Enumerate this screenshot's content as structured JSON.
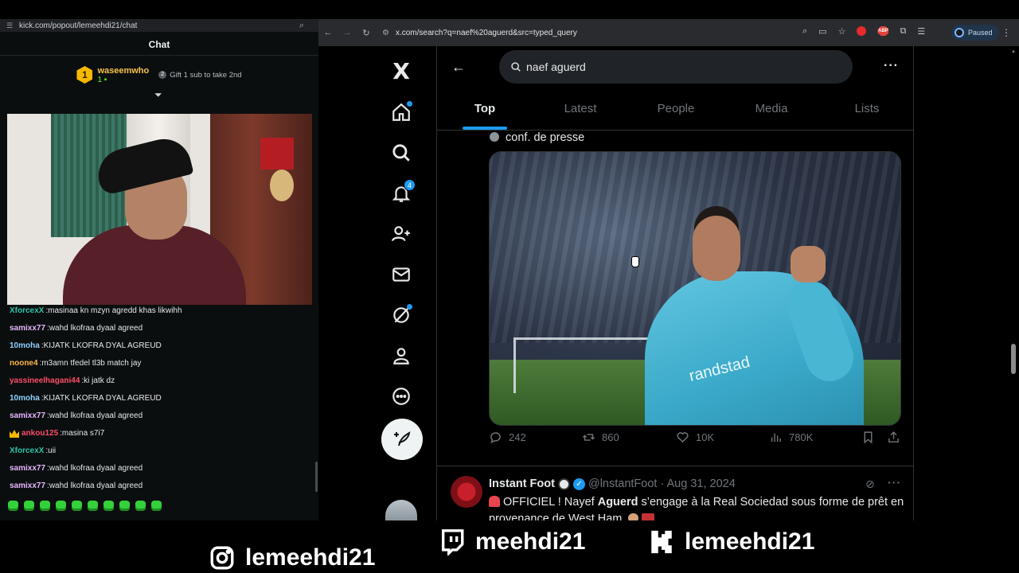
{
  "kick": {
    "url": "kick.com/popout/lemeehdi21/chat",
    "title": "Chat",
    "top_gifter": {
      "rank": "1",
      "name": "waseemwho",
      "count": "1"
    },
    "gift_hint_rank": "2",
    "gift_hint": "Gift 1 sub to take 2nd",
    "messages": [
      {
        "user": "XforcexX",
        "color": "#2ec4a6",
        "text": "masinaa kn mzyn agredd khas likwihh",
        "crown": false
      },
      {
        "user": "samixx77",
        "color": "#e8b7ff",
        "text": "wahd lkofraa dyaal agreed",
        "crown": false
      },
      {
        "user": "10moha",
        "color": "#8fd0ff",
        "text": "KIJATK LKOFRA DYAL AGREUD",
        "crown": false
      },
      {
        "user": "noone4",
        "color": "#ffb84d",
        "text": "m3amn tfedel tl3b match jay",
        "crown": false
      },
      {
        "user": "yassineelhagani44",
        "color": "#ff4d6a",
        "text": "ki jatk dz",
        "crown": false
      },
      {
        "user": "10moha",
        "color": "#8fd0ff",
        "text": "KIJATK LKOFRA DYAL AGREUD",
        "crown": false
      },
      {
        "user": "samixx77",
        "color": "#e8b7ff",
        "text": "wahd lkofraa dyaal agreed",
        "crown": false
      },
      {
        "user": "ankou125",
        "color": "#ff4d6a",
        "text": "masina s7i7",
        "crown": true
      },
      {
        "user": "XforcexX",
        "color": "#2ec4a6",
        "text": "uii",
        "crown": false
      },
      {
        "user": "samixx77",
        "color": "#e8b7ff",
        "text": "wahd lkofraa dyaal agreed",
        "crown": false
      },
      {
        "user": "samixx77",
        "color": "#e8b7ff",
        "text": "wahd lkofraa dyaal agreed",
        "crown": false
      }
    ]
  },
  "browser": {
    "url": "x.com/search?q=naef%20aguerd&src=typed_query",
    "profile_status": "Paused",
    "ext_abp_label": "ABP"
  },
  "x": {
    "logo": "X",
    "notifications_count": "4",
    "search_query": "naef aguerd",
    "tabs": [
      "Top",
      "Latest",
      "People",
      "Media",
      "Lists"
    ],
    "active_tab": "Top",
    "prev_tweet_tail": "conf. de presse",
    "media_brand": "randstad",
    "stats": {
      "replies": "242",
      "reposts": "860",
      "likes": "10K",
      "views": "780K"
    },
    "tweet2": {
      "name": "Instant Foot",
      "handle": "@lnstantFoot",
      "date": "· Aug 31, 2024",
      "text_before": "OFFICIEL ! Nayef ",
      "text_bold": "Aguerd",
      "text_after": " s’engage à la Real Sociedad sous forme de prêt en provenance de West Ham."
    }
  },
  "overlay": {
    "instagram": "lemeehdi21",
    "twitch": "meehdi21",
    "kick": "lemeehdi21"
  },
  "colors": {
    "x_blue": "#1d9bf0",
    "kick_green": "#53fc18",
    "gold": "#f6b800"
  }
}
